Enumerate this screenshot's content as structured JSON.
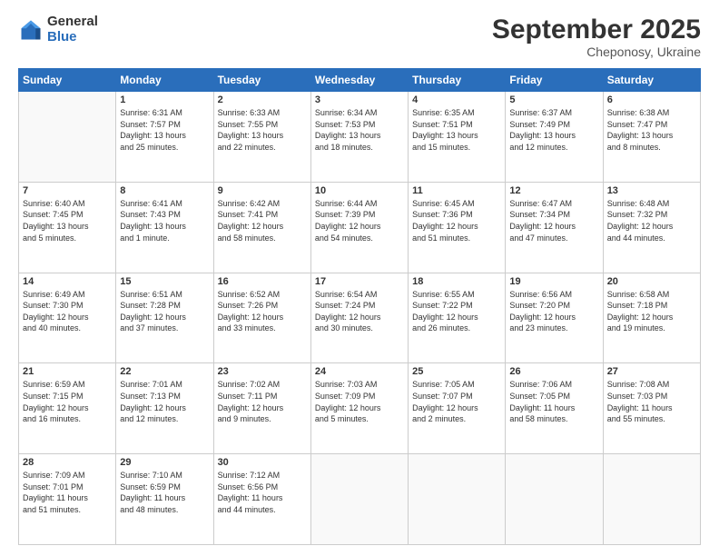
{
  "logo": {
    "general": "General",
    "blue": "Blue"
  },
  "header": {
    "month": "September 2025",
    "location": "Cheponosy, Ukraine"
  },
  "weekdays": [
    "Sunday",
    "Monday",
    "Tuesday",
    "Wednesday",
    "Thursday",
    "Friday",
    "Saturday"
  ],
  "weeks": [
    [
      {
        "day": "",
        "info": ""
      },
      {
        "day": "1",
        "info": "Sunrise: 6:31 AM\nSunset: 7:57 PM\nDaylight: 13 hours\nand 25 minutes."
      },
      {
        "day": "2",
        "info": "Sunrise: 6:33 AM\nSunset: 7:55 PM\nDaylight: 13 hours\nand 22 minutes."
      },
      {
        "day": "3",
        "info": "Sunrise: 6:34 AM\nSunset: 7:53 PM\nDaylight: 13 hours\nand 18 minutes."
      },
      {
        "day": "4",
        "info": "Sunrise: 6:35 AM\nSunset: 7:51 PM\nDaylight: 13 hours\nand 15 minutes."
      },
      {
        "day": "5",
        "info": "Sunrise: 6:37 AM\nSunset: 7:49 PM\nDaylight: 13 hours\nand 12 minutes."
      },
      {
        "day": "6",
        "info": "Sunrise: 6:38 AM\nSunset: 7:47 PM\nDaylight: 13 hours\nand 8 minutes."
      }
    ],
    [
      {
        "day": "7",
        "info": "Sunrise: 6:40 AM\nSunset: 7:45 PM\nDaylight: 13 hours\nand 5 minutes."
      },
      {
        "day": "8",
        "info": "Sunrise: 6:41 AM\nSunset: 7:43 PM\nDaylight: 13 hours\nand 1 minute."
      },
      {
        "day": "9",
        "info": "Sunrise: 6:42 AM\nSunset: 7:41 PM\nDaylight: 12 hours\nand 58 minutes."
      },
      {
        "day": "10",
        "info": "Sunrise: 6:44 AM\nSunset: 7:39 PM\nDaylight: 12 hours\nand 54 minutes."
      },
      {
        "day": "11",
        "info": "Sunrise: 6:45 AM\nSunset: 7:36 PM\nDaylight: 12 hours\nand 51 minutes."
      },
      {
        "day": "12",
        "info": "Sunrise: 6:47 AM\nSunset: 7:34 PM\nDaylight: 12 hours\nand 47 minutes."
      },
      {
        "day": "13",
        "info": "Sunrise: 6:48 AM\nSunset: 7:32 PM\nDaylight: 12 hours\nand 44 minutes."
      }
    ],
    [
      {
        "day": "14",
        "info": "Sunrise: 6:49 AM\nSunset: 7:30 PM\nDaylight: 12 hours\nand 40 minutes."
      },
      {
        "day": "15",
        "info": "Sunrise: 6:51 AM\nSunset: 7:28 PM\nDaylight: 12 hours\nand 37 minutes."
      },
      {
        "day": "16",
        "info": "Sunrise: 6:52 AM\nSunset: 7:26 PM\nDaylight: 12 hours\nand 33 minutes."
      },
      {
        "day": "17",
        "info": "Sunrise: 6:54 AM\nSunset: 7:24 PM\nDaylight: 12 hours\nand 30 minutes."
      },
      {
        "day": "18",
        "info": "Sunrise: 6:55 AM\nSunset: 7:22 PM\nDaylight: 12 hours\nand 26 minutes."
      },
      {
        "day": "19",
        "info": "Sunrise: 6:56 AM\nSunset: 7:20 PM\nDaylight: 12 hours\nand 23 minutes."
      },
      {
        "day": "20",
        "info": "Sunrise: 6:58 AM\nSunset: 7:18 PM\nDaylight: 12 hours\nand 19 minutes."
      }
    ],
    [
      {
        "day": "21",
        "info": "Sunrise: 6:59 AM\nSunset: 7:15 PM\nDaylight: 12 hours\nand 16 minutes."
      },
      {
        "day": "22",
        "info": "Sunrise: 7:01 AM\nSunset: 7:13 PM\nDaylight: 12 hours\nand 12 minutes."
      },
      {
        "day": "23",
        "info": "Sunrise: 7:02 AM\nSunset: 7:11 PM\nDaylight: 12 hours\nand 9 minutes."
      },
      {
        "day": "24",
        "info": "Sunrise: 7:03 AM\nSunset: 7:09 PM\nDaylight: 12 hours\nand 5 minutes."
      },
      {
        "day": "25",
        "info": "Sunrise: 7:05 AM\nSunset: 7:07 PM\nDaylight: 12 hours\nand 2 minutes."
      },
      {
        "day": "26",
        "info": "Sunrise: 7:06 AM\nSunset: 7:05 PM\nDaylight: 11 hours\nand 58 minutes."
      },
      {
        "day": "27",
        "info": "Sunrise: 7:08 AM\nSunset: 7:03 PM\nDaylight: 11 hours\nand 55 minutes."
      }
    ],
    [
      {
        "day": "28",
        "info": "Sunrise: 7:09 AM\nSunset: 7:01 PM\nDaylight: 11 hours\nand 51 minutes."
      },
      {
        "day": "29",
        "info": "Sunrise: 7:10 AM\nSunset: 6:59 PM\nDaylight: 11 hours\nand 48 minutes."
      },
      {
        "day": "30",
        "info": "Sunrise: 7:12 AM\nSunset: 6:56 PM\nDaylight: 11 hours\nand 44 minutes."
      },
      {
        "day": "",
        "info": ""
      },
      {
        "day": "",
        "info": ""
      },
      {
        "day": "",
        "info": ""
      },
      {
        "day": "",
        "info": ""
      }
    ]
  ]
}
